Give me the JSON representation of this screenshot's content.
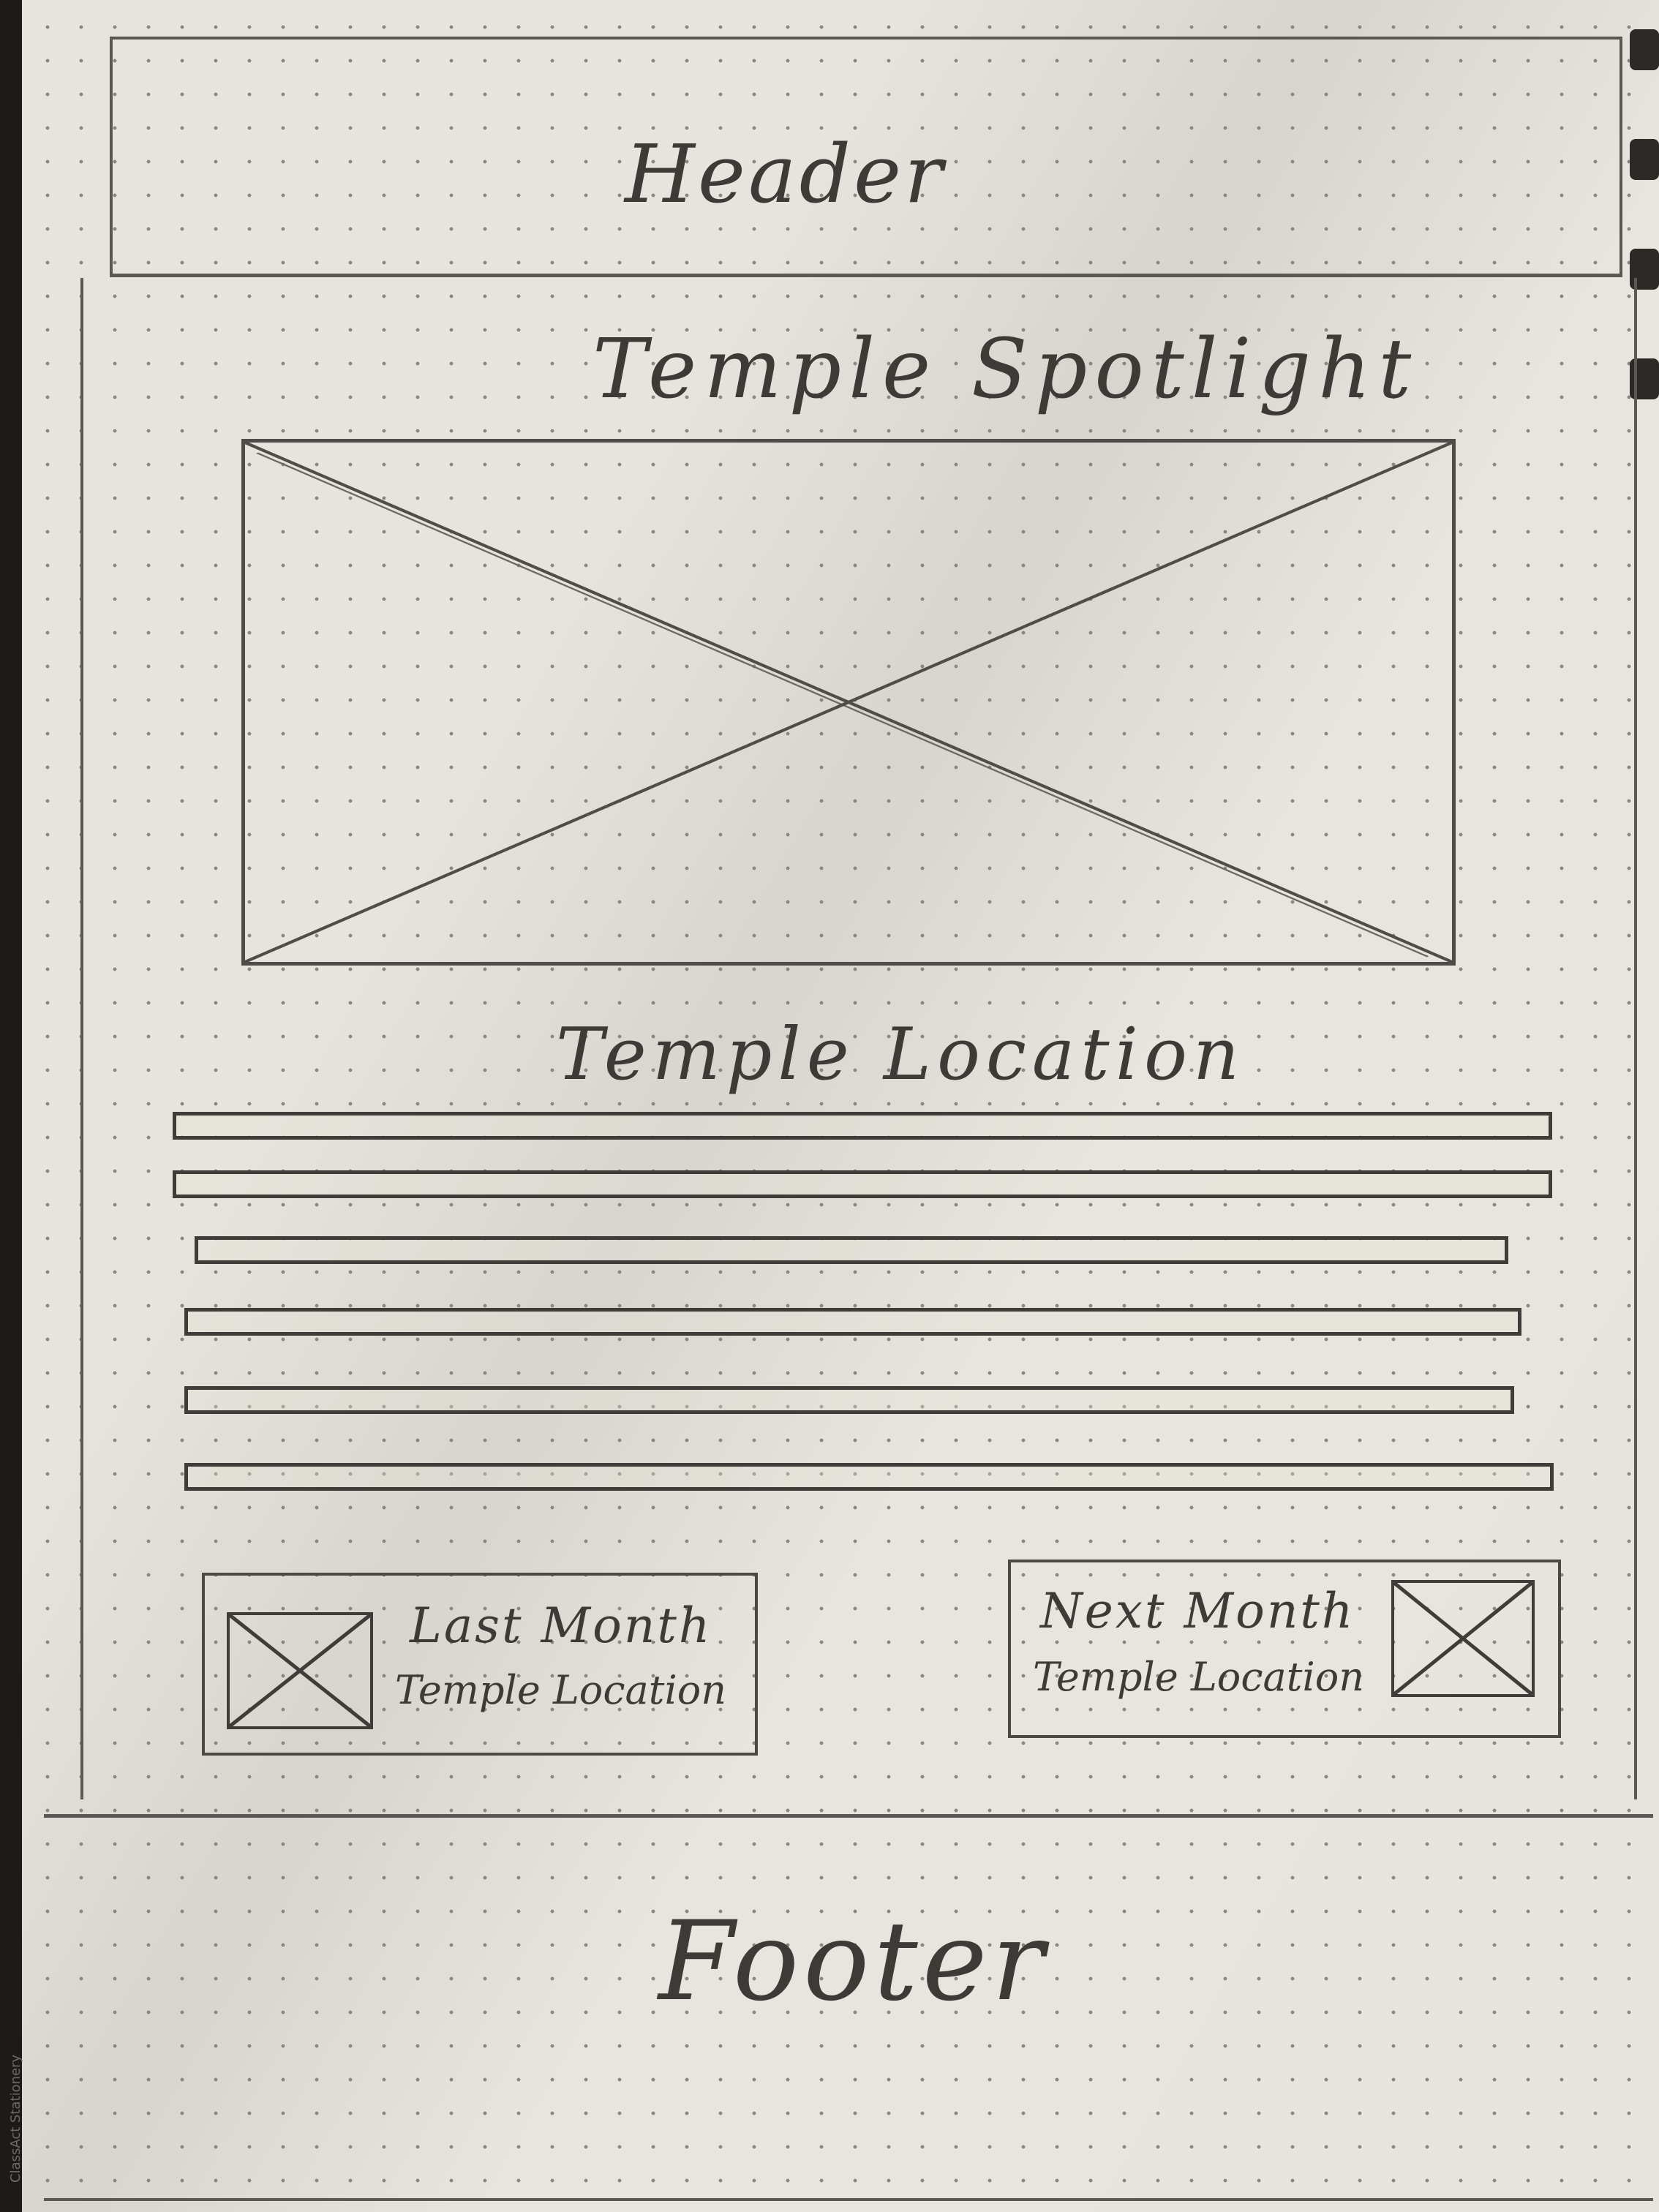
{
  "header": {
    "label": "Header"
  },
  "main": {
    "title": "Temple Spotlight",
    "image_placeholder_icon": "image-placeholder-x-icon",
    "location_heading": "Temple Location",
    "text_lines": 6
  },
  "nav": {
    "previous": {
      "line1": "Last Month",
      "line2": "Temple Location",
      "icon": "image-placeholder-x-icon"
    },
    "next": {
      "line1": "Next Month",
      "line2": "Temple Location",
      "icon": "image-placeholder-x-icon"
    }
  },
  "footer": {
    "label": "Footer"
  },
  "paper": {
    "brand": "ClassAct Stationery"
  },
  "colors": {
    "paper": "#e6e4dc",
    "pencil": "#4a4945",
    "background": "#1d1b18"
  }
}
